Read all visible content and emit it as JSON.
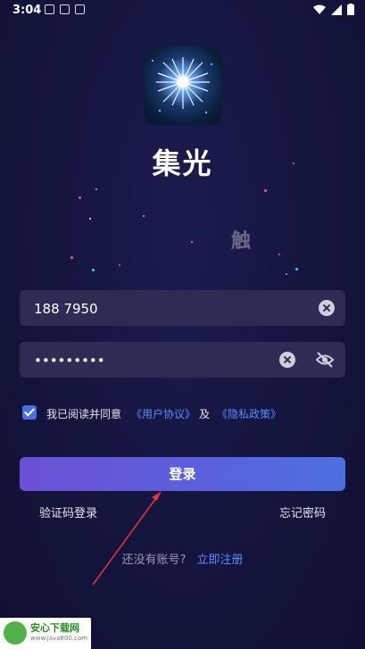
{
  "status_bar": {
    "time": "3:04"
  },
  "app": {
    "title": "集光",
    "overlay_char": "触"
  },
  "phone": {
    "value": "188 7950",
    "placeholder": ""
  },
  "password": {
    "value": "•••••••••",
    "placeholder": ""
  },
  "agreement": {
    "checked": true,
    "prefix": "我已阅读并同意",
    "user_agreement": "《用户协议》",
    "and": "及",
    "privacy_policy": "《隐私政策》"
  },
  "buttons": {
    "login": "登录",
    "sms_login": "验证码登录",
    "forgot_password": "忘记密码"
  },
  "register": {
    "no_account": "还没有账号?",
    "register_now": "立即注册"
  },
  "badge": {
    "title": "安心下载网",
    "url": "www.java800.com"
  },
  "icons": {
    "logo": "firework-logo-icon",
    "clear": "clear-icon",
    "eye": "eye-off-icon",
    "check": "check-icon"
  },
  "colors": {
    "accent": "#5b8cff",
    "button_start": "#6b4fd4",
    "button_end": "#4e6fe0",
    "background": "#14153d",
    "input_bg": "#2c2c55"
  }
}
